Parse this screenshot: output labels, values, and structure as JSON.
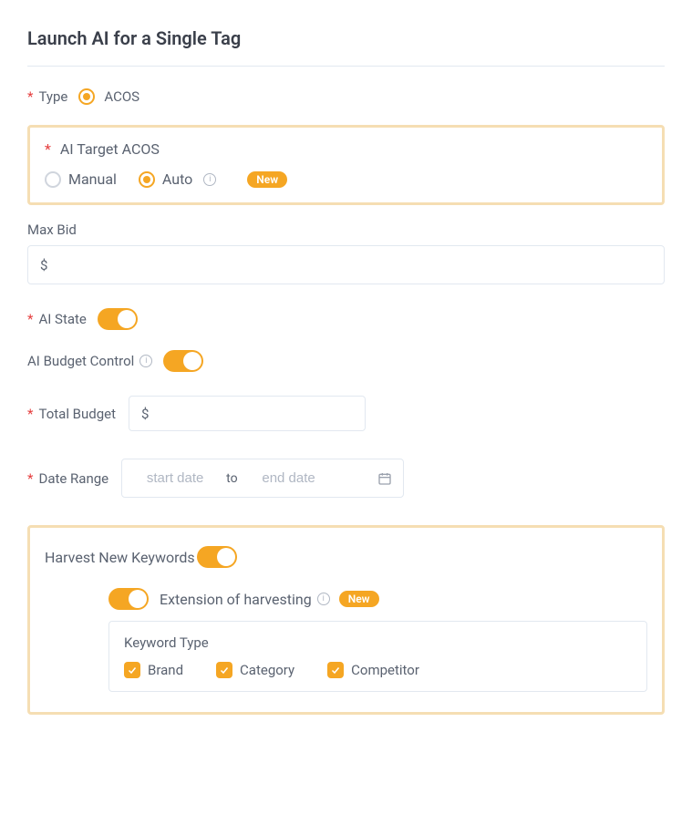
{
  "title": "Launch AI for a Single Tag",
  "fields": {
    "type": {
      "label": "Type",
      "option": "ACOS"
    },
    "aiTargetAcos": {
      "label": "AI Target ACOS",
      "options": {
        "manual": "Manual",
        "auto": "Auto"
      },
      "badge": "New"
    },
    "maxBid": {
      "label": "Max Bid",
      "currency": "$"
    },
    "aiState": {
      "label": "AI State"
    },
    "aiBudgetControl": {
      "label": "AI Budget Control"
    },
    "totalBudget": {
      "label": "Total Budget",
      "currency": "$"
    },
    "dateRange": {
      "label": "Date Range",
      "startPlaceholder": "start date",
      "separator": "to",
      "endPlaceholder": "end date"
    },
    "harvest": {
      "label": "Harvest New Keywords",
      "extensionLabel": "Extension of harvesting",
      "extensionBadge": "New",
      "keywordTypeLabel": "Keyword Type",
      "types": {
        "brand": "Brand",
        "category": "Category",
        "competitor": "Competitor"
      }
    }
  }
}
